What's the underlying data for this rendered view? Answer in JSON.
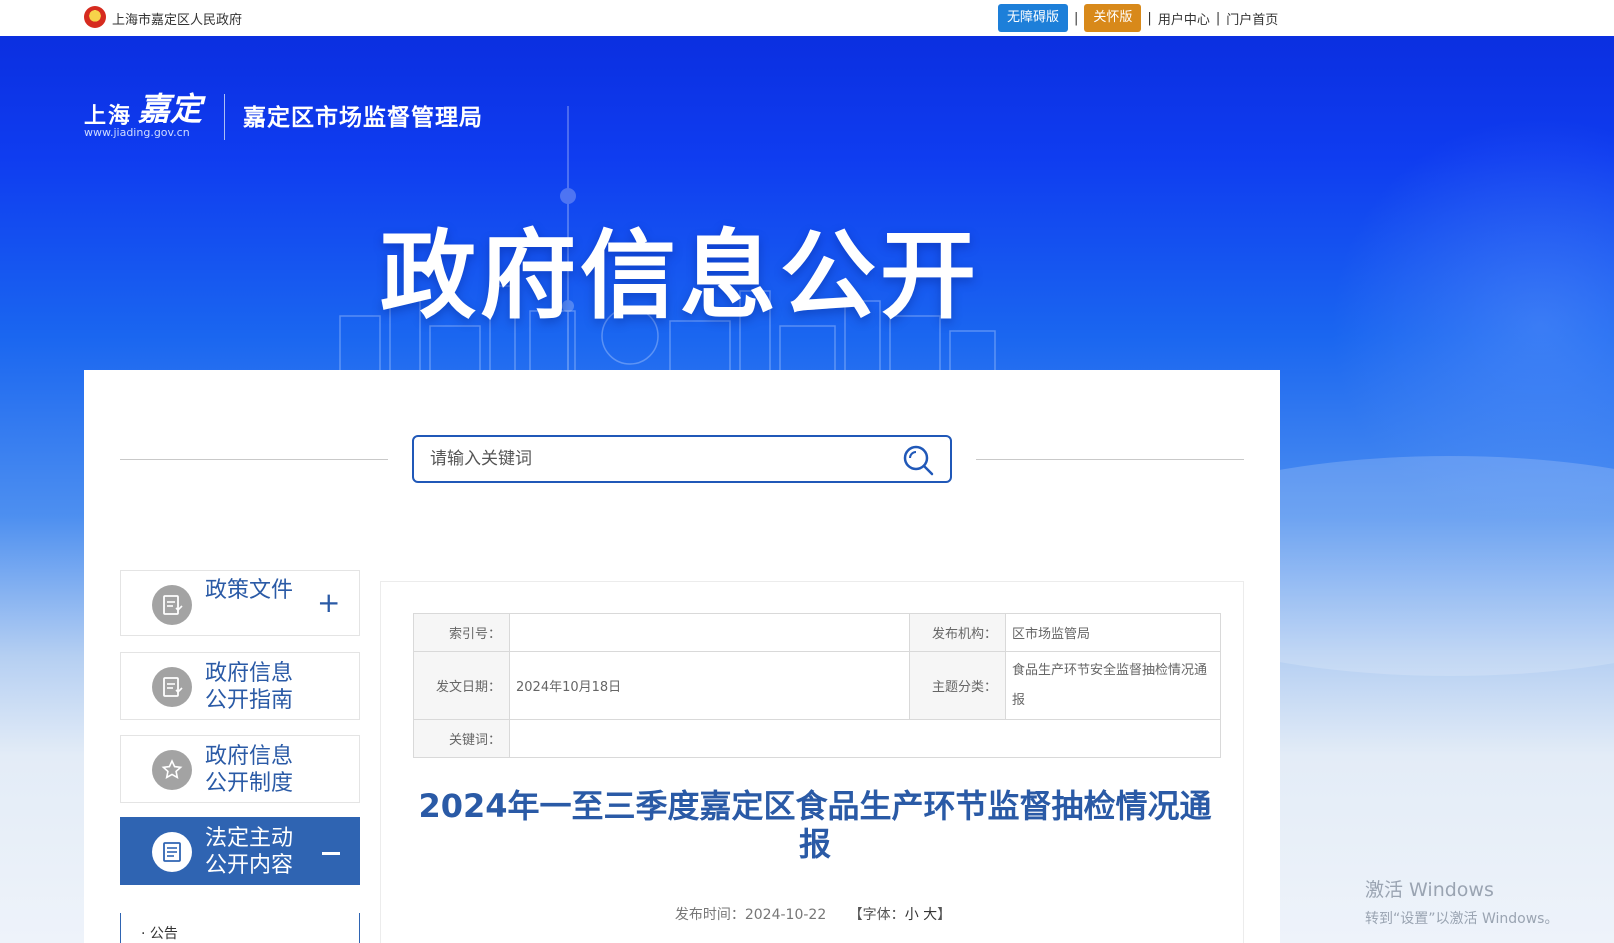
{
  "topbar": {
    "gov_name": "上海市嘉定区人民政府",
    "accessibility_label": "无障碍版",
    "care_label": "关怀版",
    "separator": "|",
    "user_center": "用户中心",
    "portal_home": "门户首页"
  },
  "header": {
    "logo_text": "上海",
    "logo_mark": "嘉定",
    "logo_domain": "www.jiading.gov.cn",
    "bureau": "嘉定区市场监督管理局",
    "banner_title": "政府信息公开"
  },
  "search": {
    "placeholder": "请输入关键词"
  },
  "sidebar": {
    "items": [
      {
        "label": "政策文件"
      },
      {
        "label1": "政府信息",
        "label2": "公开指南"
      },
      {
        "label1": "政府信息",
        "label2": "公开制度"
      },
      {
        "label1": "法定主动",
        "label2": "公开内容"
      }
    ],
    "expand_symbol": "+",
    "sub_item": "· 公告"
  },
  "meta": {
    "index_no_label": "索引号：",
    "index_no_value": "",
    "publisher_label": "发布机构：",
    "publisher_value": "区市场监管局",
    "doc_date_label": "发文日期：",
    "doc_date_value": "2024年10月18日",
    "topic_label": "主题分类：",
    "topic_value": "食品生产环节安全监督抽检情况通报",
    "keywords_label": "关键词：",
    "keywords_value": ""
  },
  "article": {
    "title": "2024年一至三季度嘉定区食品生产环节监督抽检情况通报",
    "publish_time": "发布时间：2024-10-22",
    "font_label": "【字体：",
    "font_small": "小",
    "font_large": "大",
    "font_close": "】"
  },
  "watermark": {
    "line1": "激活 Windows",
    "line2": "转到“设置”以激活 Windows。"
  }
}
